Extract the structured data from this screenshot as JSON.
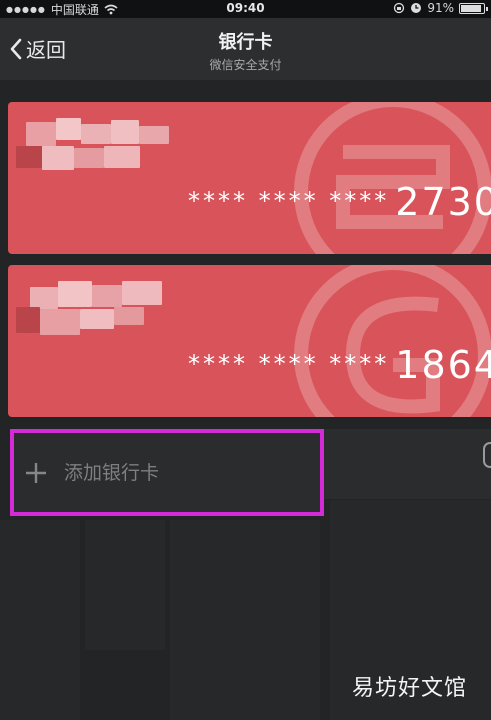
{
  "status_bar": {
    "carrier": "中国联通",
    "time": "09:40",
    "battery_text": "91%",
    "battery_level": 0.91
  },
  "nav": {
    "back_label": "返回",
    "title": "银行卡",
    "subtitle": "微信安全支付"
  },
  "cards": [
    {
      "mask": "**** **** ****",
      "last_digits": "2730"
    },
    {
      "mask": "**** **** ****",
      "last_digits": "1864"
    }
  ],
  "add_card": {
    "label": "添加银行卡"
  },
  "watermark": "易坊好文馆",
  "colors": {
    "card": "#d8545a",
    "highlight": "#d42bd6",
    "background": "#222425",
    "nav": "#2c2e30"
  }
}
